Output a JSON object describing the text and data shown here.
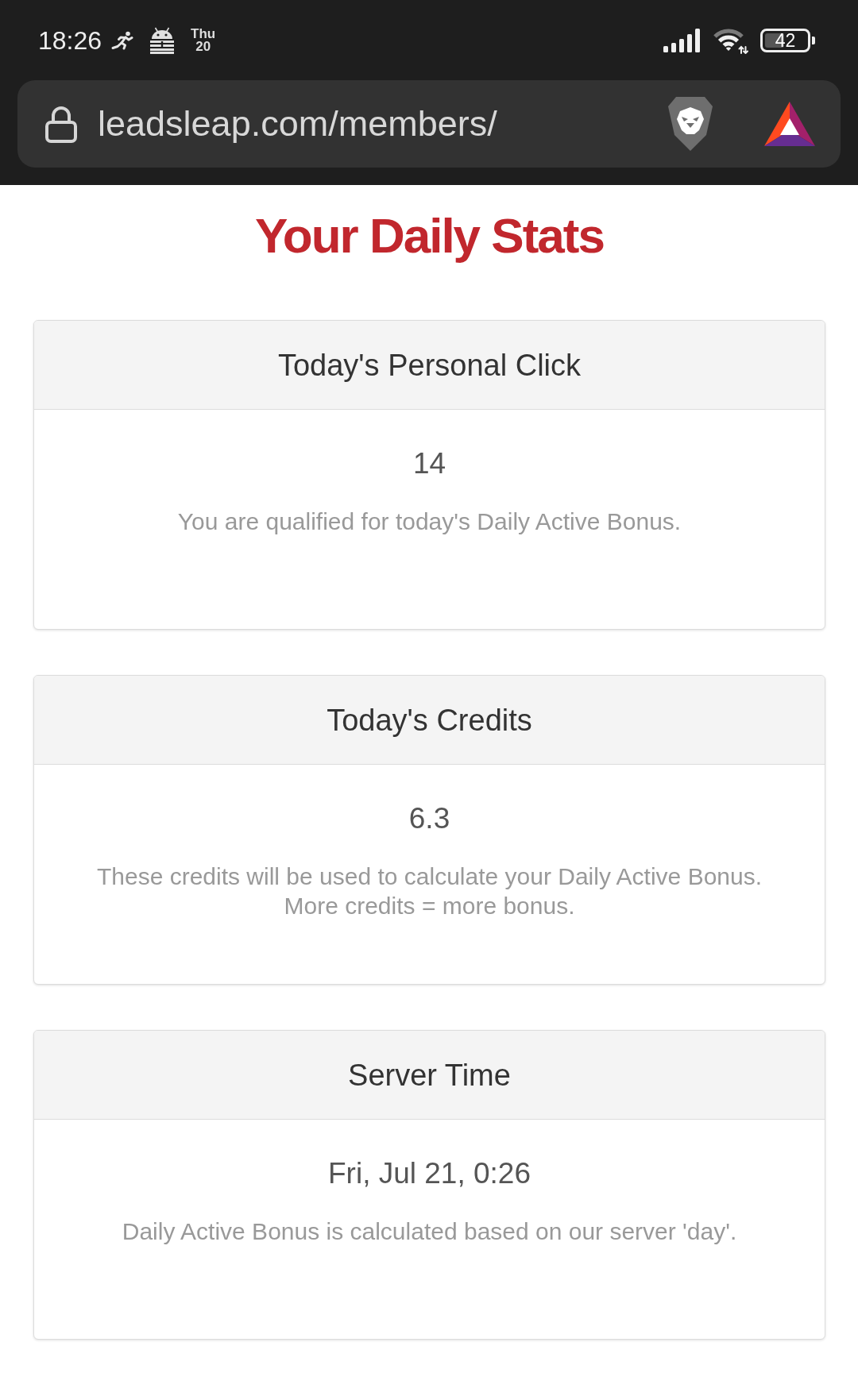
{
  "status_bar": {
    "time": "18:26",
    "weekday": "Thu",
    "day": "20",
    "battery": "42"
  },
  "address_bar": {
    "url": "leadsleap.com/members/"
  },
  "title": "Your Daily Stats",
  "cards": [
    {
      "heading": "Today's Personal Click",
      "value": "14",
      "note_lines": [
        "You are qualified for today's Daily Active Bonus."
      ]
    },
    {
      "heading": "Today's Credits",
      "value": "6.3",
      "note_lines": [
        "These credits will be used to calculate your Daily Active Bonus.",
        "More credits = more bonus."
      ]
    },
    {
      "heading": "Server Time",
      "value": "Fri, Jul 21, 0:26",
      "note_lines": [
        "Daily Active Bonus is calculated based on our server 'day'."
      ]
    }
  ]
}
